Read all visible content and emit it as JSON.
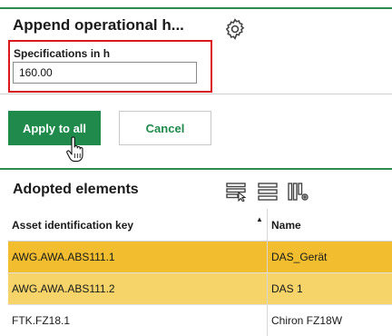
{
  "panel": {
    "title": "Append operational h...",
    "field_label": "Specifications in h",
    "field_value": "160.00"
  },
  "buttons": {
    "apply_label": "Apply to all",
    "cancel_label": "Cancel"
  },
  "adopted": {
    "title": "Adopted elements",
    "columns": [
      "Asset identification key",
      "Name"
    ],
    "rows": [
      {
        "key": "AWG.AWA.ABS111.1",
        "name": "DAS_Gerät",
        "highlight": "#f2bd2f"
      },
      {
        "key": "AWG.AWA.ABS111.2",
        "name": "DAS 1",
        "highlight": "#f6d469"
      },
      {
        "key": "FTK.FZ18.1",
        "name": "Chiron FZ18W",
        "highlight": "#ffffff"
      }
    ]
  },
  "colors": {
    "accent_green": "#1f8a4c",
    "error_red": "#d9191c"
  },
  "icons": [
    "gear-icon",
    "select-rows-icon",
    "list-view-icon",
    "column-settings-icon",
    "hand-cursor-icon",
    "sort-ascending-icon"
  ]
}
